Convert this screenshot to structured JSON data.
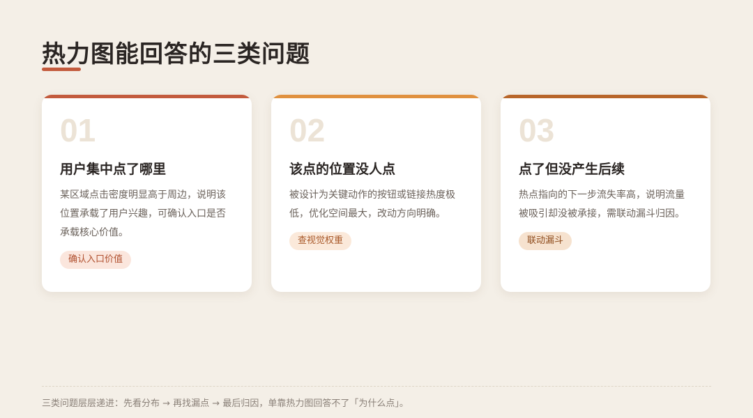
{
  "page": {
    "title": "热力图能回答的三类问题",
    "accent_color": "#c35b3d"
  },
  "cards": [
    {
      "number": "01",
      "heading": "用户集中点了哪里",
      "description": "某区域点击密度明显高于周边，说明该位置承载了用户兴趣，可确认入口是否承载核心价值。",
      "tag": "确认入口价值",
      "accent_color": "#c35b3d",
      "tag_bg": "#fbe6dd",
      "tag_color": "#b0502f"
    },
    {
      "number": "02",
      "heading": "该点的位置没人点",
      "description": "被设计为关键动作的按钮或链接热度极低，优化空间最大，改动方向明确。",
      "tag": "查视觉权重",
      "accent_color": "#e0913f",
      "tag_bg": "#fbe9da",
      "tag_color": "#a9592a"
    },
    {
      "number": "03",
      "heading": "点了但没产生后续",
      "description": "热点指向的下一步流失率高，说明流量被吸引却没被承接，需联动漏斗归因。",
      "tag": "联动漏斗",
      "accent_color": "#b8662a",
      "tag_bg": "#f6e2cf",
      "tag_color": "#8f4d1e"
    }
  ],
  "footer": {
    "note": "三类问题层层递进：先看分布 → 再找漏点 → 最后归因，单靠热力图回答不了「为什么点」。"
  }
}
